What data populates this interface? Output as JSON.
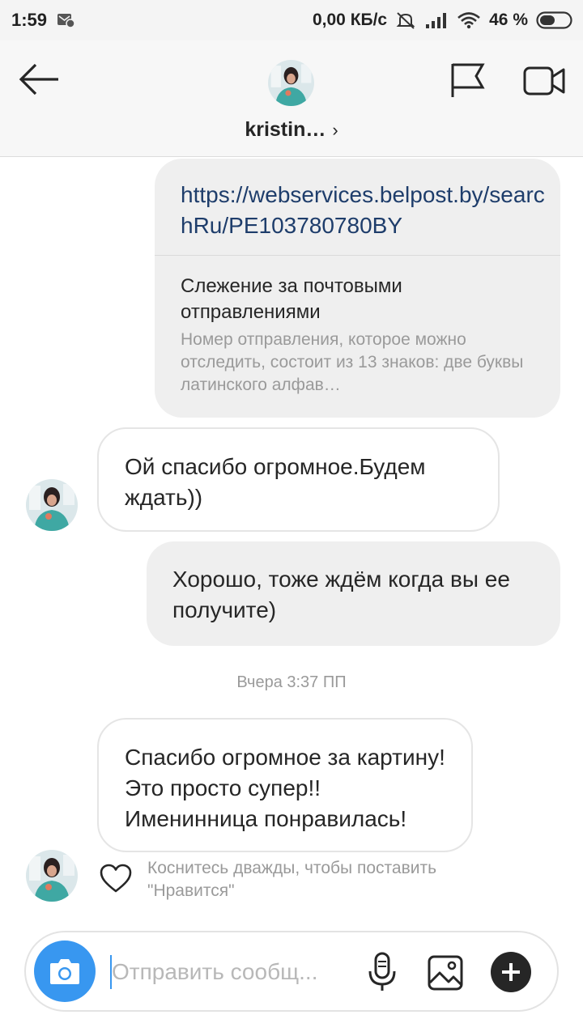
{
  "status_bar": {
    "time": "1:59",
    "net_speed": "0,00 КБ/с",
    "battery": "46 %"
  },
  "header": {
    "username": "kristin…",
    "chevron": "›"
  },
  "messages": {
    "link": {
      "url": "https://webservices.belpost.by/searchRu/PE103780780BY",
      "title": "Слежение за почтовыми отправлениями",
      "description": "Номер отправления, которое можно отследить, состоит из 13 знаков: две буквы латинского алфав…"
    },
    "in_1": "Ой спасибо огромное.Будем ждать))",
    "out_1": "Хорошо, тоже ждём когда вы ее получите)",
    "timestamp": "Вчера 3:37 ПП",
    "in_2": "Спасибо огромное за картину!Это просто супер!! Именинница понравилась!",
    "like_hint": "Коснитесь дважды, чтобы поставить \"Нравится\""
  },
  "composer": {
    "placeholder": "Отправить сообщ..."
  },
  "colors": {
    "accent": "#3897f0",
    "link": "#1e3d6b",
    "bubble_out": "#efefef",
    "muted": "#9a9a9a"
  },
  "icons": {
    "back": "arrow-left-icon",
    "flag": "flag-icon",
    "video": "video-camera-icon",
    "camera": "camera-icon",
    "mic": "microphone-icon",
    "gallery": "image-icon",
    "plus": "plus-icon",
    "heart": "heart-icon"
  }
}
